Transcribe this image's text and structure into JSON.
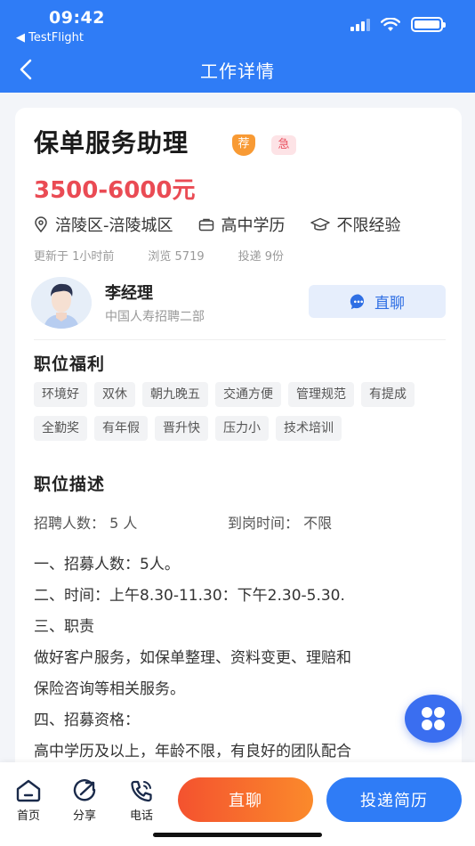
{
  "status_bar": {
    "time": "09:42",
    "back_app": "◀ TestFlight"
  },
  "nav": {
    "title": "工作详情"
  },
  "job": {
    "title": "保单服务助理",
    "tag_recommend": "荐",
    "tag_urgent": "急",
    "salary": "3500-6000元",
    "location": "涪陵区-涪陵城区",
    "education": "高中学历",
    "experience": "不限经验",
    "updated": "更新于 1小时前",
    "views": "浏览 5719",
    "applications": "投递 9份"
  },
  "contact": {
    "name": "李经理",
    "org": "中国人寿招聘二部",
    "chat_label": "直聊"
  },
  "benefits": {
    "title": "职位福利",
    "items": [
      "环境好",
      "双休",
      "朝九晚五",
      "交通方便",
      "管理规范",
      "有提成",
      "全勤奖",
      "有年假",
      "晋升快",
      "压力小",
      "技术培训"
    ]
  },
  "description": {
    "title": "职位描述",
    "hire_count": "招聘人数： 5 人",
    "start_time": "到岗时间： 不限",
    "lines": [
      "一、招募人数：5人。",
      "二、时间：上午8.30-11.30：下午2.30-5.30.",
      "三、职责",
      "做好客户服务，如保单整理、资料变更、理赔和",
      "保险咨询等相关服务。",
      "四、招募资格：",
      "高中学历及以上，年龄不限，有良好的团队配合"
    ]
  },
  "bottom_bar": {
    "home": "首页",
    "share": "分享",
    "phone": "电话",
    "chat": "直聊",
    "apply": "投递简历"
  },
  "colors": {
    "primary": "#2f7cf6",
    "salary": "#ea4b54",
    "recommend_tag": "#f89a34",
    "urgent_tag": "#ea5362"
  }
}
